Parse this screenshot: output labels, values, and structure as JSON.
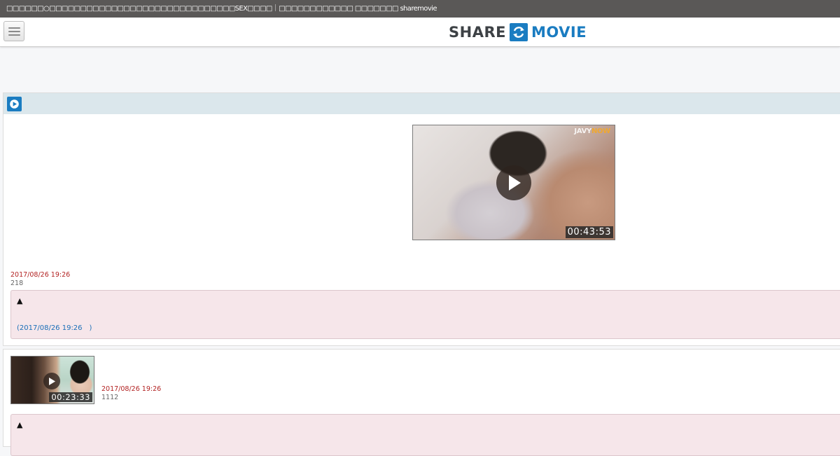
{
  "window": {
    "title": "□□□□□□○□□□□□□□□□□□□□□□□□□□□□□□□□□□□□□SEX□□□□｜□□□□□□□□□□□□ □□□□□□□ sharemovie"
  },
  "header": {
    "logo_left": "SHARE",
    "logo_right": "MOVIE",
    "menu_icon": "hamburger-icon"
  },
  "posts": [
    {
      "watermark_a": "JAVY",
      "watermark_b": "NOW",
      "duration": "00:43:53",
      "date": "2017/08/26 19:26",
      "count": "218",
      "comment": {
        "arrow": "▲",
        "timestamp": "(2017/08/26 19:26　)"
      }
    },
    {
      "watermark": "",
      "duration": "00:23:33",
      "date": "2017/08/26 19:26",
      "count": "1112",
      "comment": {
        "arrow": "▲"
      }
    }
  ],
  "colors": {
    "accent": "#1a7cc1",
    "date": "#b22222",
    "comment_bg": "#f6e6ea",
    "section_head": "#dbe7ec"
  }
}
